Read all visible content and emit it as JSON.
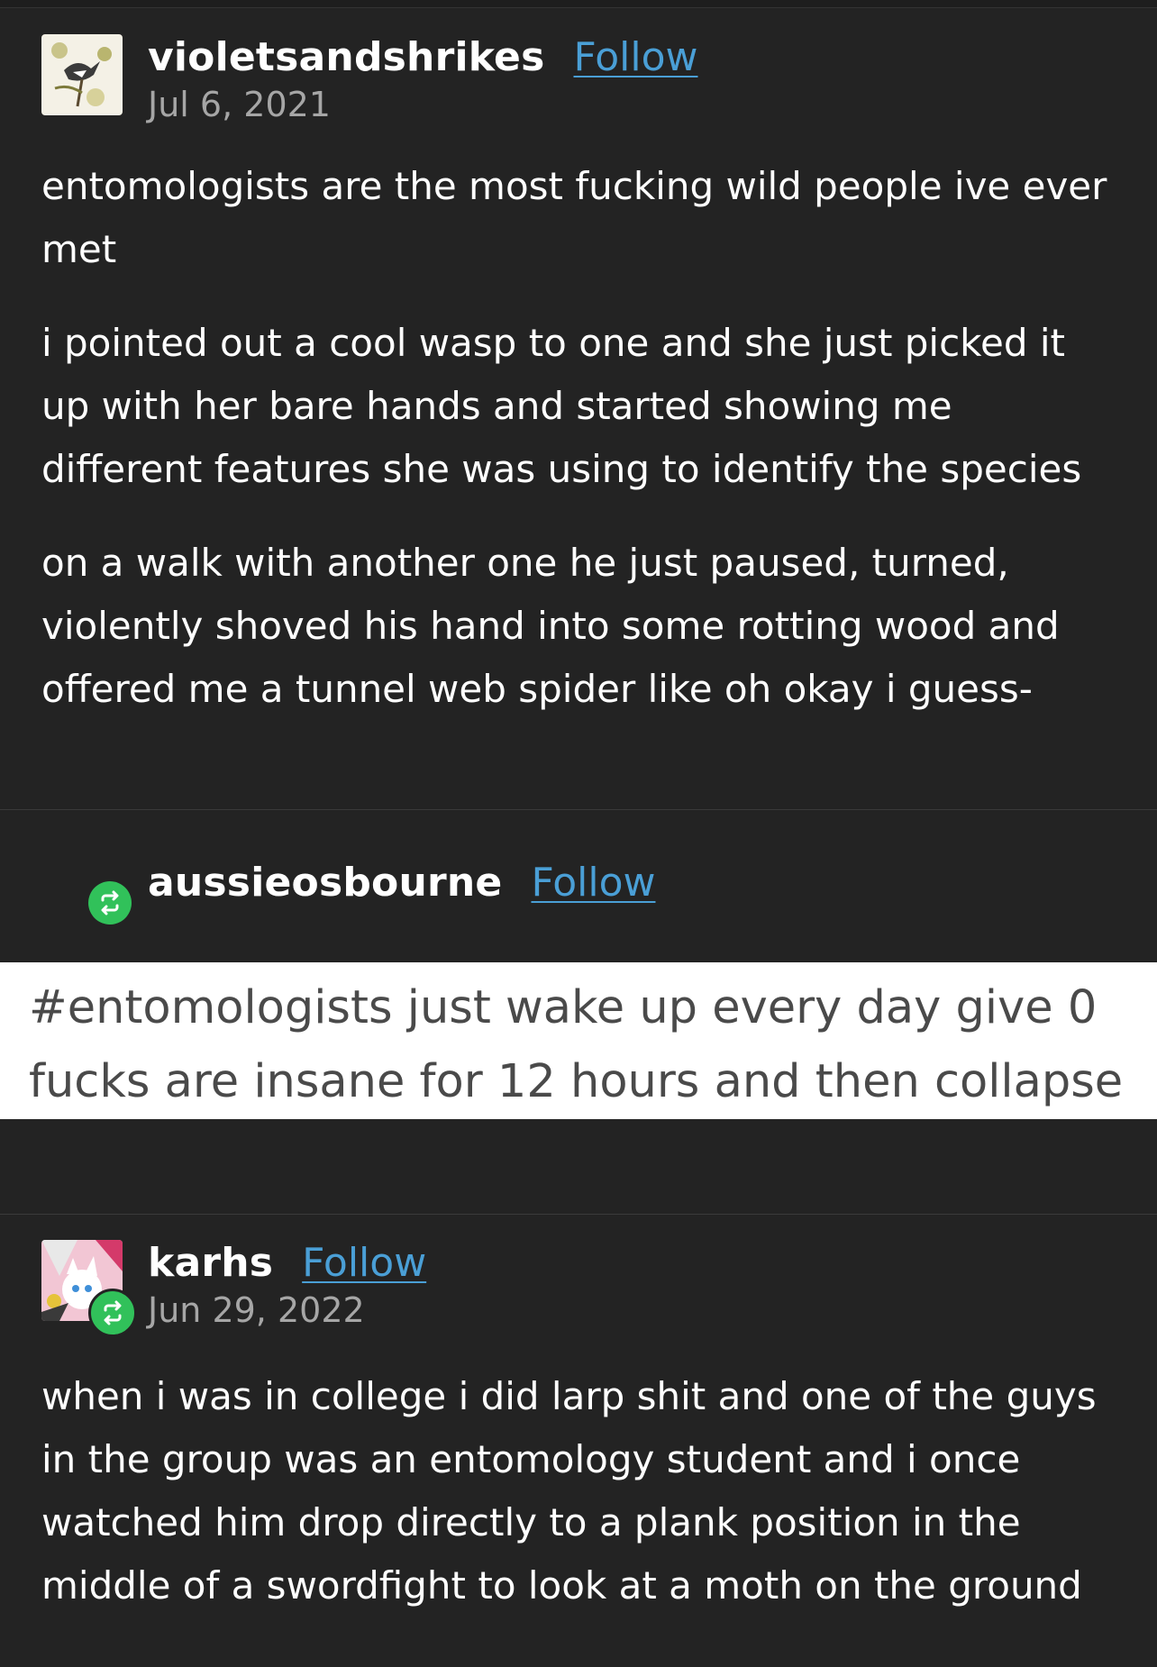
{
  "posts": [
    {
      "username": "violetsandshrikes",
      "follow_label": "Follow",
      "date": "Jul 6, 2021",
      "paragraphs": [
        "entomologists are the most fucking wild people ive ever met",
        "i pointed out a cool wasp to one and she just picked it up with her bare hands and started showing me different features she was using to identify the species",
        "on a walk with another one he just paused, turned, violently shoved his hand into some rotting wood and offered me a tunnel web spider like oh okay i guess-"
      ]
    },
    {
      "username": "aussieosbourne",
      "follow_label": "Follow",
      "tags": "#entomologists just wake up every day give 0 fucks are insane for 12 hours and then collapse"
    },
    {
      "username": "karhs",
      "follow_label": "Follow",
      "date": "Jun 29, 2022",
      "paragraphs": [
        "when i was in college i did larp shit and one of the guys in the group was an entomology student and i once watched him drop directly to a plank position in the middle of a swordfight to look at a moth on the ground"
      ]
    }
  ],
  "icons": {
    "reblog": "reblog-icon",
    "avatar1": "bird-avatar",
    "avatar3": "character-avatar"
  },
  "colors": {
    "background": "#232323",
    "follow_link": "#4a9fd6",
    "reblog_badge": "#31c15a",
    "date_text": "#a6a6a6"
  }
}
